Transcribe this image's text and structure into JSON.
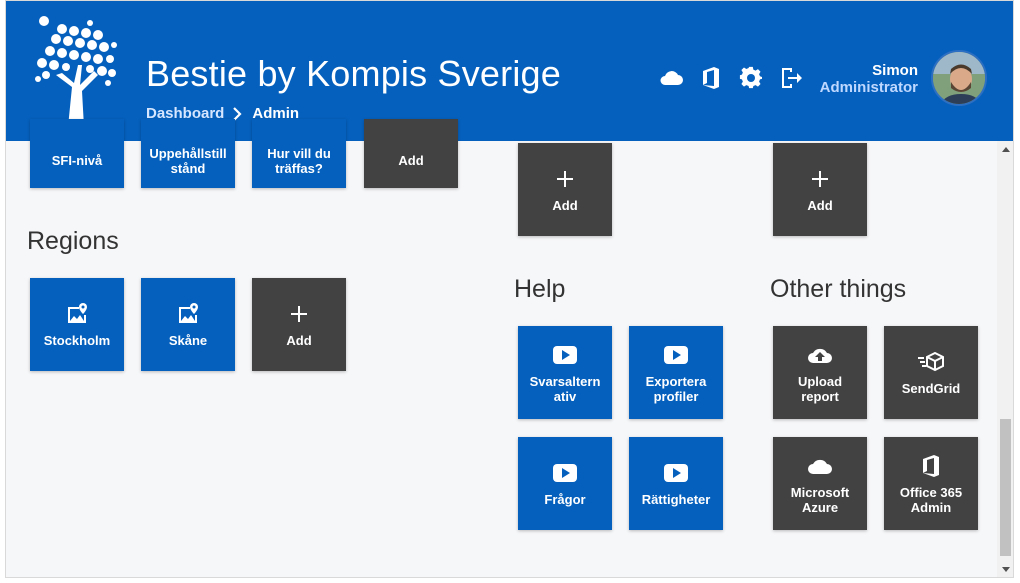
{
  "header": {
    "title": "Bestie by Kompis Sverige",
    "breadcrumb": {
      "root": "Dashboard",
      "current": "Admin"
    },
    "icons": [
      "cloud-icon",
      "office-icon",
      "gear-icon",
      "logout-icon"
    ],
    "user": {
      "name": "Simon",
      "role": "Administrator"
    },
    "colors": {
      "brand": "#0560bd",
      "tile_dark": "#424242",
      "page_bg": "#f6f7f9"
    }
  },
  "top_row_tiles": [
    "SFI-nivå",
    "Uppehållstill stånd",
    "Hur vill du träffas?",
    "Add"
  ],
  "right_add_tiles": [
    "Add",
    "Add"
  ],
  "regions": {
    "title": "Regions",
    "tiles": [
      "Stockholm",
      "Skåne",
      "Add"
    ]
  },
  "help": {
    "title": "Help",
    "tiles": [
      "Svarsaltern ativ",
      "Exportera profiler",
      "Frågor",
      "Rättigheter"
    ]
  },
  "other": {
    "title": "Other things",
    "tiles": [
      "Upload report",
      "SendGrid",
      "Microsoft Azure",
      "Office 365 Admin"
    ]
  }
}
